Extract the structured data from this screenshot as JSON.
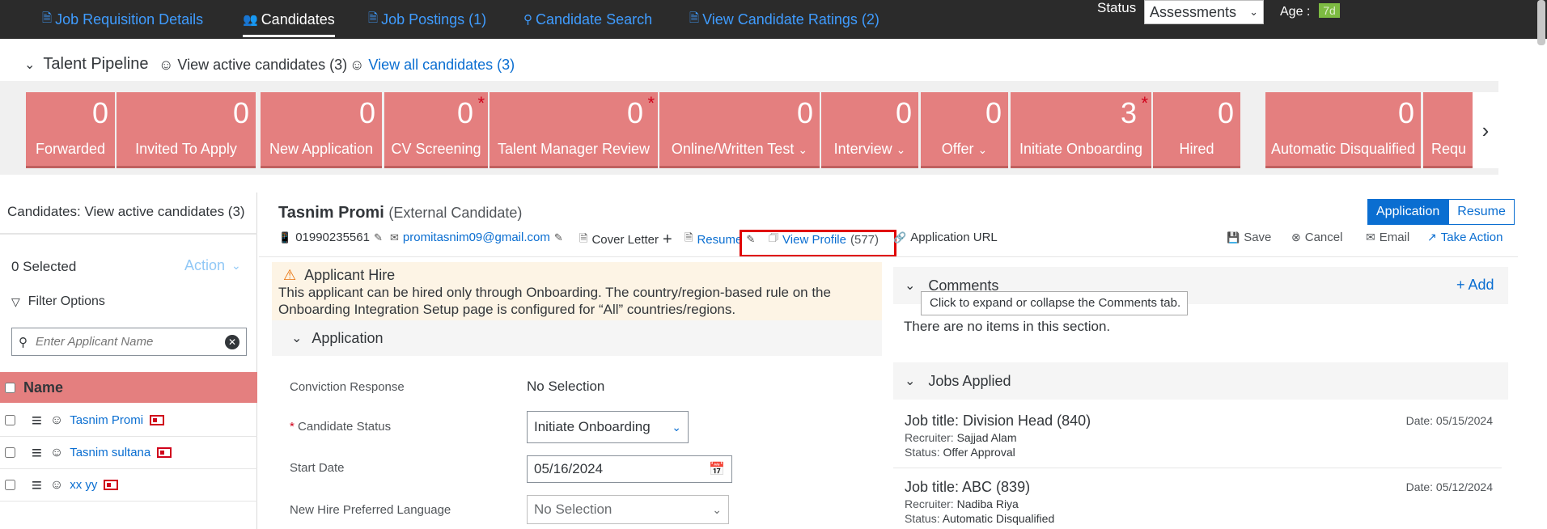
{
  "top_nav": {
    "tabs": [
      {
        "label": "Job Requisition Details",
        "icon": "document-icon"
      },
      {
        "label": "Candidates",
        "icon": "people-icon",
        "active": true
      },
      {
        "label": "Job Postings (1)",
        "icon": "document-icon"
      },
      {
        "label": "Candidate Search",
        "icon": "search-icon"
      },
      {
        "label": "View Candidate Ratings (2)",
        "icon": "document-icon"
      }
    ],
    "status_label": "Status",
    "status_value": "Assessments",
    "age_label": "Age :",
    "age_value": "7d"
  },
  "pipeline": {
    "title": "Talent Pipeline",
    "view_active": "View active candidates (3)",
    "view_all": "View all candidates (3)",
    "stages": [
      {
        "count": "0",
        "label": "Forwarded"
      },
      {
        "count": "0",
        "label": "Invited To Apply"
      },
      {
        "count": "0",
        "label": "New Application"
      },
      {
        "count": "0",
        "label": "CV Screening",
        "star": true
      },
      {
        "count": "0",
        "label": "Talent Manager Review",
        "star": true
      },
      {
        "count": "0",
        "label": "Online/Written Test",
        "dropdown": true
      },
      {
        "count": "0",
        "label": "Interview",
        "dropdown": true
      },
      {
        "count": "0",
        "label": "Offer",
        "dropdown": true
      },
      {
        "count": "3",
        "label": "Initiate Onboarding",
        "star": true
      },
      {
        "count": "0",
        "label": "Hired"
      },
      {
        "count": "0",
        "label": "Automatic Disqualified"
      },
      {
        "count": "",
        "label": "Requ"
      }
    ]
  },
  "left_panel": {
    "header": "Candidates: View active candidates (3)",
    "selected": "0 Selected",
    "action": "Action",
    "filter_options": "Filter Options",
    "search_placeholder": "Enter Applicant Name",
    "column_name": "Name",
    "candidates": [
      {
        "name": "Tasnim Promi"
      },
      {
        "name": "Tasnim sultana"
      },
      {
        "name": "xx yy"
      }
    ]
  },
  "candidate": {
    "name": "Tasnim Promi",
    "type": "(External Candidate)",
    "phone": "01990235561",
    "email": "promitasnim09@gmail.com",
    "cover_letter": "Cover Letter",
    "resume": "Resume",
    "view_profile": "View Profile",
    "view_profile_count": "(577)",
    "application_url": "Application URL",
    "toggle_application": "Application",
    "toggle_resume": "Resume",
    "actions": {
      "save": "Save",
      "cancel": "Cancel",
      "email": "Email",
      "take_action": "Take Action"
    }
  },
  "alert": {
    "title": "Applicant Hire",
    "message": "This applicant can be hired only through Onboarding. The country/region-based rule on the Onboarding Integration Setup page is configured for “All” countries/regions."
  },
  "application": {
    "section_title": "Application",
    "fields": {
      "conviction_label": "Conviction Response",
      "conviction_value": "No Selection",
      "status_label": "Candidate Status",
      "status_value": "Initiate Onboarding",
      "start_date_label": "Start Date",
      "start_date_value": "05/16/2024",
      "language_label": "New Hire Preferred Language",
      "language_value": "No Selection"
    }
  },
  "comments": {
    "title": "Comments",
    "add": "+ Add",
    "tooltip": "Click to expand or collapse the Comments tab.",
    "empty": "There are no items in this section."
  },
  "jobs_applied": {
    "title": "Jobs Applied",
    "recruiter_label": "Recruiter:",
    "status_label": "Status:",
    "jobs": [
      {
        "title": "Job title: Division Head (840)",
        "recruiter": "Sajjad Alam",
        "status": "Offer Approval",
        "date": "Date: 05/15/2024"
      },
      {
        "title": "Job title: ABC (839)",
        "recruiter": "Nadiba Riya",
        "status": "Automatic Disqualified",
        "date": "Date: 05/12/2024"
      }
    ]
  },
  "colors": {
    "stage_bg": "#e47f7f",
    "accent": "#0a6ed1",
    "topbar": "#2b2b2b",
    "highlight": "#e00000"
  }
}
